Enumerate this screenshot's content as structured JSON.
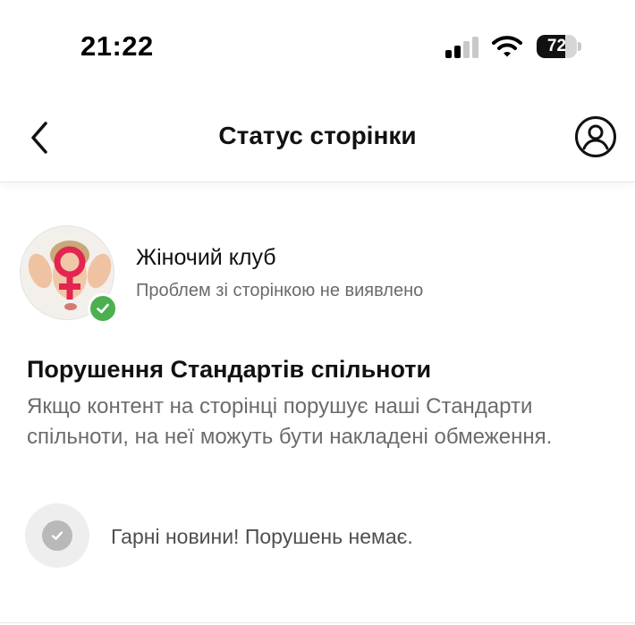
{
  "status_bar": {
    "time": "21:22",
    "battery_level": "72",
    "battery_fraction": 0.72,
    "icons": [
      "cellular-signal-icon",
      "wifi-icon",
      "battery-icon"
    ]
  },
  "header": {
    "back_icon": "chevron-left-icon",
    "title": "Статус сторінки",
    "account_icon": "person-circle-icon"
  },
  "page": {
    "name": "Жіночий клуб",
    "status": "Проблем зі сторінкою не виявлено",
    "avatar": "page-avatar",
    "badge_icon": "check-icon",
    "badge_color": "#4caf50"
  },
  "violations": {
    "title": "Порушення Стандартів спільноти",
    "description": "Якщо контент на сторінці порушує наші Стандарти спільноти, на неї можуть бути накладені обмеження.",
    "result_icon": "check-circle-icon",
    "result_text": "Гарні новини! Порушень немає."
  },
  "colors": {
    "accent_symbol": "#e3254f",
    "secondary_text": "#6b6b6b"
  }
}
